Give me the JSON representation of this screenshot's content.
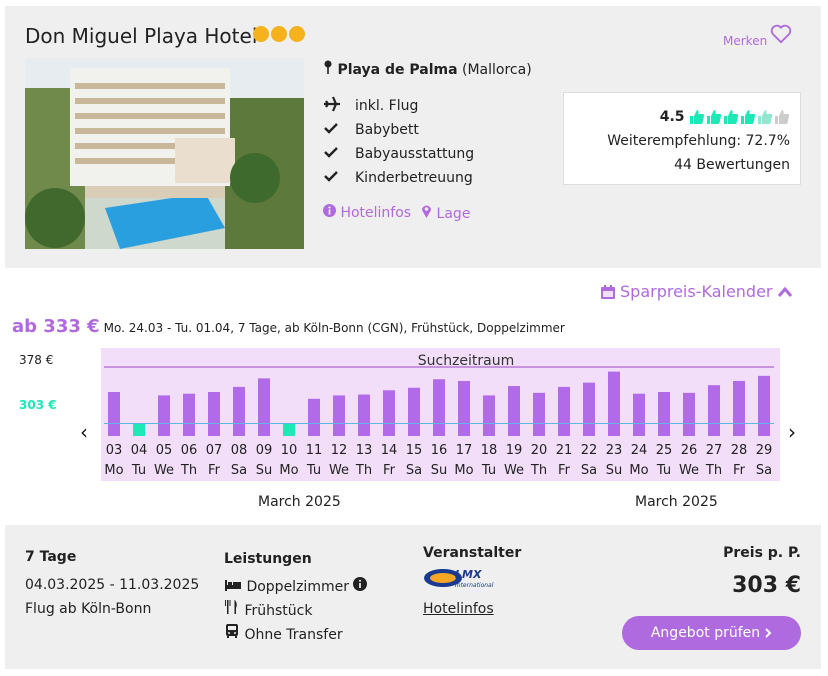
{
  "hotel": {
    "name": "Don Miguel Playa Hotel",
    "stars": 3,
    "star_color": "#f5b21d",
    "merken": "Merken",
    "location_bold": "Playa de Palma",
    "location_rest": "(Mallorca)",
    "features": [
      {
        "icon": "plane-icon",
        "label": "inkl. Flug"
      },
      {
        "icon": "check-icon",
        "label": "Babybett"
      },
      {
        "icon": "check-icon",
        "label": "Babyausstattung"
      },
      {
        "icon": "check-icon",
        "label": "Kinderbetreuung"
      }
    ],
    "link_infos": "Hotelinfos",
    "link_lage": "Lage"
  },
  "rating": {
    "score": "4.5",
    "thumbs_filled": 4.5,
    "thumbs_total": 6,
    "recommend": "Weiterempfehlung: 72.7%",
    "reviews": "44 Bewertungen"
  },
  "calendar": {
    "link": "Sparpreis-Kalender",
    "price_prefix": "ab 333 €",
    "price_detail": "Mo. 24.03 - Tu. 01.04, 7 Tage, ab Köln-Bonn (CGN), Frühstück, Doppelzimmer",
    "y_high": "378 €",
    "y_low": "303 €",
    "range_label": "Suchzeitraum",
    "month_left": "March 2025",
    "month_right": "March 2025"
  },
  "chart_data": {
    "type": "bar",
    "ylim": [
      300,
      380
    ],
    "x": [
      "03",
      "04",
      "05",
      "06",
      "07",
      "08",
      "09",
      "10",
      "11",
      "12",
      "13",
      "14",
      "15",
      "16",
      "17",
      "18",
      "19",
      "20",
      "21",
      "22",
      "23",
      "24",
      "25",
      "26",
      "27",
      "28",
      "29"
    ],
    "weekdays": [
      "Mo",
      "Tu",
      "We",
      "Th",
      "Fr",
      "Sa",
      "Su",
      "Mo",
      "Tu",
      "We",
      "Th",
      "Fr",
      "Sa",
      "Su",
      "Mo",
      "Tu",
      "We",
      "Th",
      "Fr",
      "Sa",
      "Su",
      "Mo",
      "Tu",
      "We",
      "Th",
      "Fr",
      "Sa"
    ],
    "values": [
      340,
      303,
      336,
      338,
      340,
      346,
      356,
      303,
      332,
      336,
      337,
      342,
      345,
      355,
      353,
      336,
      347,
      339,
      346,
      351,
      364,
      338,
      340,
      339,
      348,
      353,
      359
    ],
    "highlight": [
      1,
      7
    ],
    "bar_color": "#b16ae8",
    "highlight_color": "#1de9b6",
    "reference_line": 303
  },
  "offer": {
    "days": "7 Tage",
    "dates": "04.03.2025 - 11.03.2025",
    "flight": "Flug ab Köln-Bonn",
    "leistungen_title": "Leistungen",
    "room": "Doppelzimmer",
    "board": "Frühstück",
    "transfer": "Ohne Transfer",
    "veranstalter_title": "Veranstalter",
    "operator_logo": "LMX",
    "operator_logo_sub": "International",
    "operator_link": "Hotelinfos",
    "price_title": "Preis p. P.",
    "price": "303 €",
    "button": "Angebot prüfen"
  }
}
